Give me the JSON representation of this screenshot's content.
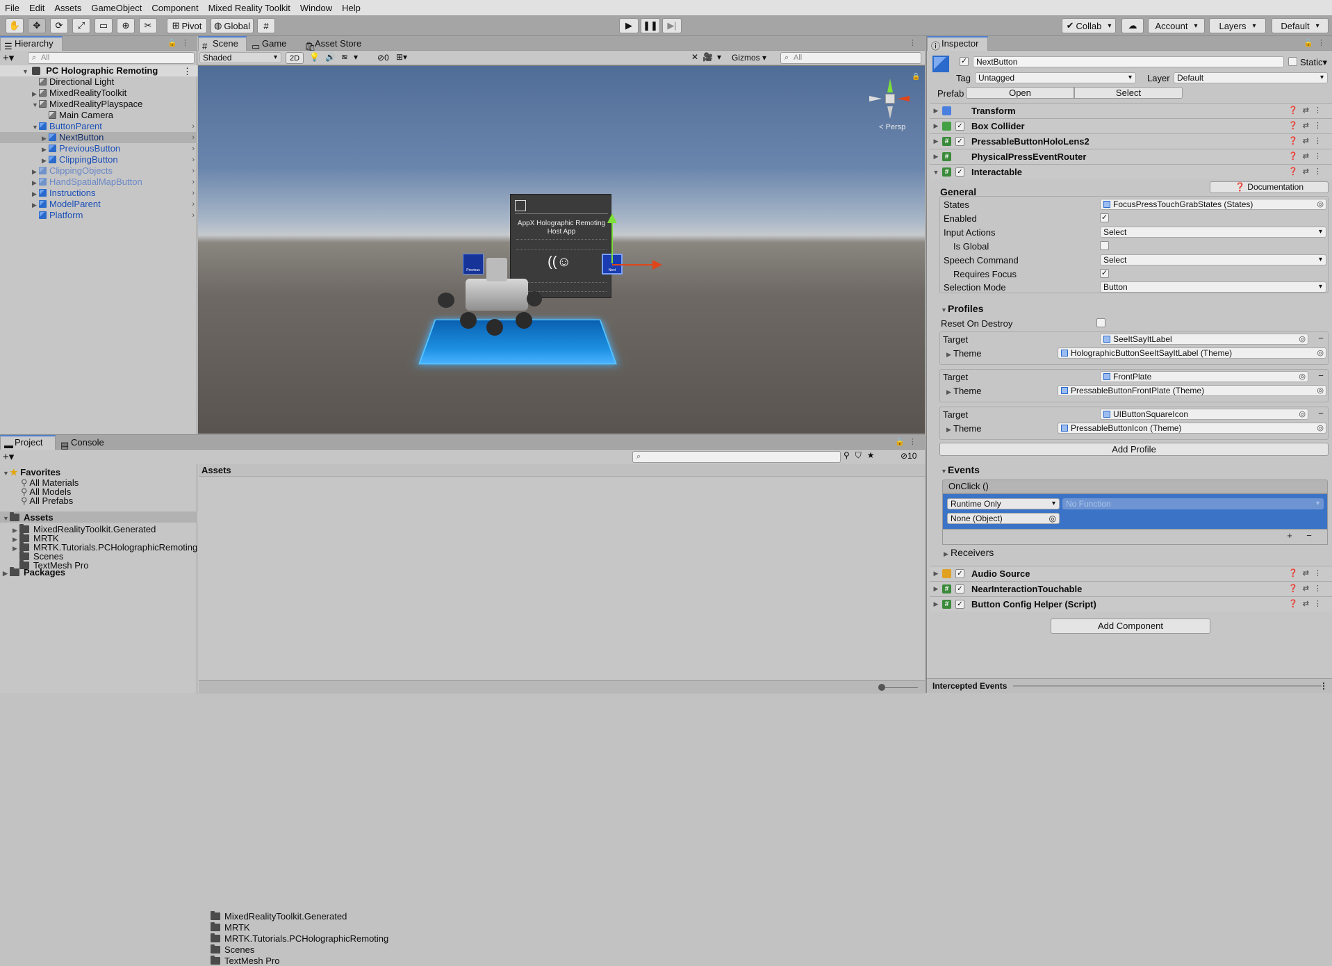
{
  "menu": [
    "File",
    "Edit",
    "Assets",
    "GameObject",
    "Component",
    "Mixed Reality Toolkit",
    "Window",
    "Help"
  ],
  "toolbar": {
    "pivot_label": "Pivot",
    "global_label": "Global",
    "collab_label": "Collab",
    "account_label": "Account",
    "layers_label": "Layers",
    "layout_label": "Default",
    "tool_icons": [
      "hand-tool-icon",
      "move-tool-icon",
      "rotate-tool-icon",
      "scale-tool-icon",
      "rect-tool-icon",
      "transform-tool-icon",
      "custom-tool-icon"
    ],
    "play_icons": [
      "play-icon",
      "pause-icon",
      "step-icon"
    ]
  },
  "hierarchy": {
    "tab_label": "Hierarchy",
    "search_placeholder": "All",
    "scene_name": "PC Holographic Remoting",
    "items": [
      {
        "label": "Directional Light",
        "depth": 1,
        "type": "grey",
        "arrow": ""
      },
      {
        "label": "MixedRealityToolkit",
        "depth": 1,
        "type": "grey",
        "arrow": "▶"
      },
      {
        "label": "MixedRealityPlayspace",
        "depth": 1,
        "type": "grey",
        "arrow": "▼"
      },
      {
        "label": "Main Camera",
        "depth": 2,
        "type": "grey",
        "arrow": ""
      },
      {
        "label": "ButtonParent",
        "depth": 1,
        "type": "blue",
        "arrow": "▼"
      },
      {
        "label": "NextButton",
        "depth": 2,
        "type": "blue-selected",
        "arrow": "▶"
      },
      {
        "label": "PreviousButton",
        "depth": 2,
        "type": "blue",
        "arrow": "▶"
      },
      {
        "label": "ClippingButton",
        "depth": 2,
        "type": "blue",
        "arrow": "▶"
      },
      {
        "label": "ClippingObjects",
        "depth": 1,
        "type": "faded",
        "arrow": "▶"
      },
      {
        "label": "HandSpatialMapButton",
        "depth": 1,
        "type": "faded",
        "arrow": "▶"
      },
      {
        "label": "Instructions",
        "depth": 1,
        "type": "blue",
        "arrow": "▶"
      },
      {
        "label": "ModelParent",
        "depth": 1,
        "type": "blue",
        "arrow": "▶"
      },
      {
        "label": "Platform",
        "depth": 1,
        "type": "blue",
        "arrow": ""
      }
    ]
  },
  "scene": {
    "tabs": [
      "Scene",
      "Game",
      "Asset Store"
    ],
    "shading_mode": "Shaded",
    "mode_2d": "2D",
    "hidden_count": "0",
    "gizmos_label": "Gizmos",
    "search_placeholder": "All",
    "persp_label": "< Persp",
    "panel_title": "AppX Holographic Remoting Host App",
    "prev_label": "Previous",
    "next_label": "Next",
    "colors": {
      "sky_top": "#5d7aa4",
      "ground": "#5a5450",
      "platform": "#1c8fe0"
    }
  },
  "project": {
    "tabs": [
      "Project",
      "Console"
    ],
    "hidden_count": "10",
    "favorites_label": "Favorites",
    "favorites": [
      "All Materials",
      "All Models",
      "All Prefabs"
    ],
    "assets_label": "Assets",
    "asset_folders": [
      "MixedRealityToolkit.Generated",
      "MRTK",
      "MRTK.Tutorials.PCHolographicRemoting",
      "Scenes",
      "TextMesh Pro"
    ],
    "packages_label": "Packages",
    "breadcrumb": "Assets",
    "content_items": [
      "MixedRealityToolkit.Generated",
      "MRTK",
      "MRTK.Tutorials.PCHolographicRemoting",
      "Scenes",
      "TextMesh Pro"
    ]
  },
  "inspector": {
    "tab_label": "Inspector",
    "object_name": "NextButton",
    "static_label": "Static",
    "tag_label": "Tag",
    "tag_value": "Untagged",
    "layer_label": "Layer",
    "layer_value": "Default",
    "prefab_label": "Prefab",
    "prefab_open": "Open",
    "prefab_select": "Select",
    "components_top": [
      {
        "name": "Transform",
        "icon": "transform-icon",
        "color": "#4a7fe0",
        "checkbox": false
      },
      {
        "name": "Box Collider",
        "icon": "box-collider-icon",
        "color": "#45a045",
        "checkbox": true
      },
      {
        "name": "PressableButtonHoloLens2",
        "icon": "script-icon",
        "color": "#3a8a3a",
        "checkbox": true
      },
      {
        "name": "PhysicalPressEventRouter",
        "icon": "script-icon",
        "color": "#3a8a3a",
        "checkbox": false
      },
      {
        "name": "Interactable",
        "icon": "script-icon",
        "color": "#3a8a3a",
        "checkbox": true
      }
    ],
    "documentation_label": "Documentation",
    "general_label": "General",
    "states_label": "States",
    "states_value": "FocusPressTouchGrabStates (States)",
    "enabled_label": "Enabled",
    "input_actions_label": "Input Actions",
    "input_actions_value": "Select",
    "is_global_label": "Is Global",
    "speech_command_label": "Speech Command",
    "speech_command_value": "Select",
    "requires_focus_label": "Requires Focus",
    "selection_mode_label": "Selection Mode",
    "selection_mode_value": "Button",
    "profiles_label": "Profiles",
    "reset_on_destroy_label": "Reset On Destroy",
    "profiles": [
      {
        "target_label": "Target",
        "target": "SeeItSayItLabel",
        "theme_label": "Theme",
        "theme": "HolographicButtonSeeItSayItLabel (Theme)"
      },
      {
        "target_label": "Target",
        "target": "FrontPlate",
        "theme_label": "Theme",
        "theme": "PressableButtonFrontPlate (Theme)"
      },
      {
        "target_label": "Target",
        "target": "UIButtonSquareIcon",
        "theme_label": "Theme",
        "theme": "PressableButtonIcon (Theme)"
      }
    ],
    "add_profile_label": "Add Profile",
    "events_label": "Events",
    "onclick_label": "OnClick ()",
    "runtime_value": "Runtime Only",
    "function_value": "No Function",
    "object_value": "None (Object)",
    "receivers_label": "Receivers",
    "components_bottom": [
      {
        "name": "Audio Source",
        "icon": "audio-source-icon",
        "color": "#e0a020",
        "checkbox": true
      },
      {
        "name": "NearInteractionTouchable",
        "icon": "script-icon",
        "color": "#3a8a3a",
        "checkbox": true
      },
      {
        "name": "Button Config Helper (Script)",
        "icon": "script-icon",
        "color": "#3a8a3a",
        "checkbox": true
      }
    ],
    "add_component_label": "Add Component",
    "intercepted_events_label": "Intercepted Events",
    "colors": {
      "event_selected": "#3b73c7"
    }
  }
}
